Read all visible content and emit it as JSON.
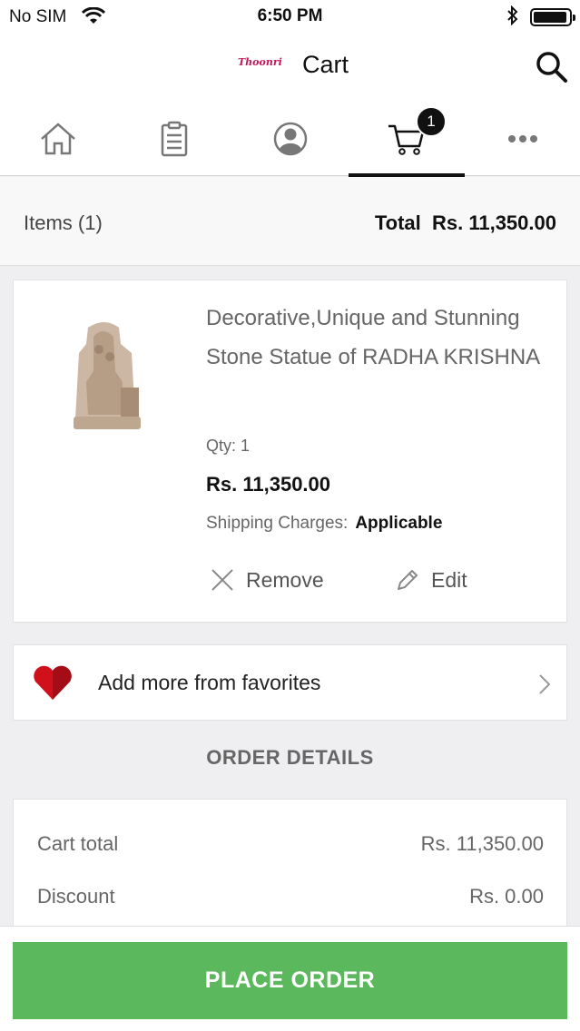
{
  "status_bar": {
    "carrier": "No SIM",
    "time": "6:50 PM"
  },
  "nav": {
    "logo": "Thoonri",
    "title": "Cart"
  },
  "tabs": [
    {
      "icon": "home-icon"
    },
    {
      "icon": "orders-clipboard-icon"
    },
    {
      "icon": "account-icon"
    },
    {
      "icon": "cart-icon",
      "active": true,
      "badge": "1"
    },
    {
      "icon": "more-icon"
    }
  ],
  "summary": {
    "items_label": "Items (1)",
    "total_label": "Total",
    "total_value": "Rs. 11,350.00"
  },
  "product": {
    "name": "Decorative,Unique and Stunning Stone Statue of  RADHA KRISHNA",
    "qty": "Qty: 1",
    "price": "Rs. 11,350.00",
    "shipping_label": "Shipping Charges:",
    "shipping_value": "Applicable",
    "remove_label": "Remove",
    "edit_label": "Edit"
  },
  "favorites": {
    "label": "Add more from favorites"
  },
  "order_details": {
    "title": "ORDER DETAILS",
    "rows": [
      {
        "label": "Cart total",
        "value": "Rs. 11,350.00"
      },
      {
        "label": "Discount",
        "value": "Rs. 0.00"
      }
    ]
  },
  "place_order_label": "PLACE ORDER",
  "colors": {
    "accent_green": "#5cb85c",
    "heart_red": "#d0101b"
  }
}
